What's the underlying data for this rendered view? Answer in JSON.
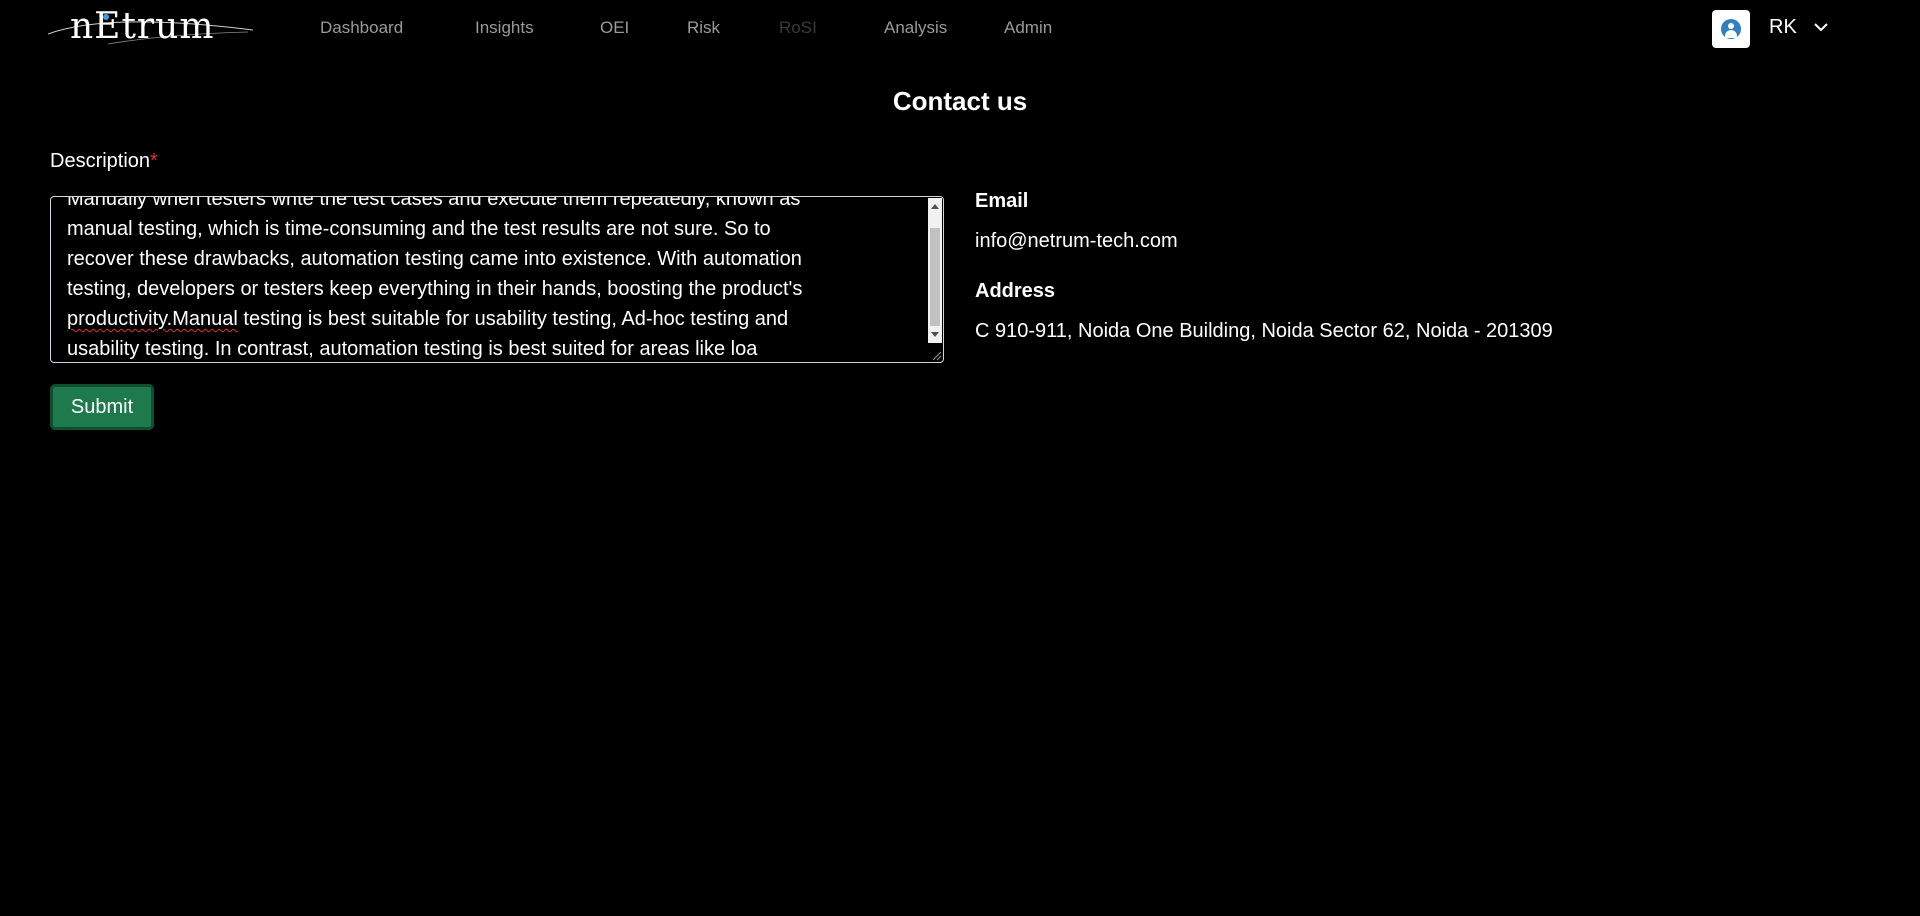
{
  "header": {
    "logo_text": "nEtrum",
    "nav": [
      {
        "label": "Dashboard",
        "disabled": false
      },
      {
        "label": "Insights",
        "disabled": false
      },
      {
        "label": "OEI",
        "disabled": false
      },
      {
        "label": "Risk",
        "disabled": false
      },
      {
        "label": "RoSI",
        "disabled": true
      },
      {
        "label": "Analysis",
        "disabled": false
      },
      {
        "label": "Admin",
        "disabled": false
      }
    ],
    "user": {
      "initials": "RK",
      "avatar_icon": "user-icon",
      "menu_icon": "chevron-down-icon"
    }
  },
  "page": {
    "title": "Contact us"
  },
  "form": {
    "description_label": "Description",
    "required_marker": "*",
    "description_lines": [
      "Manually when testers write the test cases and execute them repeatedly, known as",
      "manual testing, which is time-consuming and the test results are not sure. So to",
      "recover these drawbacks, automation testing came into existence. With automation",
      "testing, developers or testers keep everything in their hands, boosting the product's"
    ],
    "description_line5_misspelled": "productivity.Manual",
    "description_line5_rest": " testing is best suitable for usability testing, Ad-hoc testing and",
    "description_line6": "usability testing. In contrast, automation testing is best suited for areas like loa",
    "submit_label": "Submit"
  },
  "contact": {
    "email_heading": "Email",
    "email_value": "info@netrum-tech.com",
    "address_heading": "Address",
    "address_value": "C 910-911, Noida One Building, Noida Sector 62, Noida - 201309"
  },
  "colors": {
    "background": "#000000",
    "nav_text": "#9a9a9a",
    "nav_disabled": "#3a3a3a",
    "submit_bg": "#1e7a4d",
    "required": "#e03131",
    "avatar_accent": "#2f7fc1"
  }
}
